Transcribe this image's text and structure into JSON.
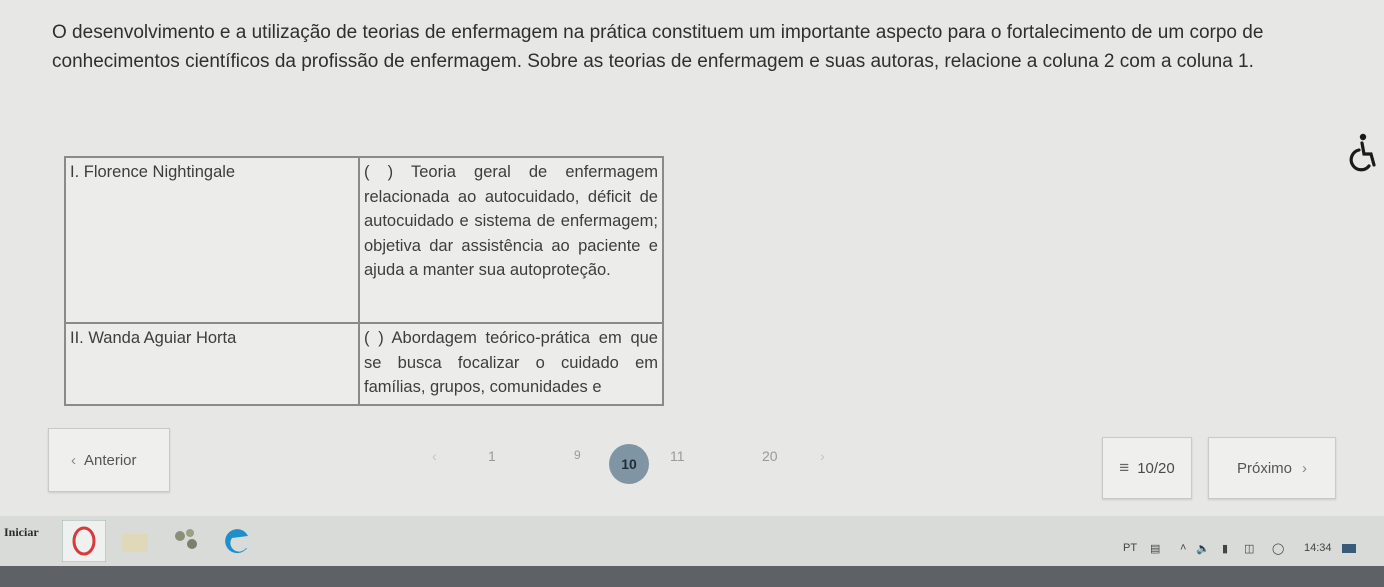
{
  "question": {
    "text": "O desenvolvimento e a utilização de teorias de enfermagem na prática constituem um importante aspecto para o fortalecimento de um corpo de conhecimentos científicos da profissão de enfermagem. Sobre as teorias de enfermagem e suas autoras, relacione a coluna 2 com a coluna 1."
  },
  "table": {
    "rows": [
      {
        "left": "I. Florence Nightingale",
        "right": "( ) Teoria geral de enfermagem relacionada ao autocuidado, déficit de autocuidado e sistema de enfermagem; objetiva dar assistência ao paciente e ajuda a manter sua autoproteção."
      },
      {
        "left": "II. Wanda Aguiar Horta",
        "right": "( ) Abordagem teórico-prática em que se busca focalizar o cuidado em famílias, grupos, comunidades e"
      }
    ]
  },
  "navigation": {
    "prev_label": "Anterior",
    "next_label": "Próximo",
    "counter": "10/20",
    "pages": [
      "1",
      "9",
      "10",
      "11",
      "20"
    ],
    "active_page": "10",
    "prev_icon": "chevron-left-icon",
    "next_icon": "chevron-right-icon",
    "list_icon": "list-icon"
  },
  "taskbar": {
    "start_label": "Iniciar",
    "language": "PT",
    "time": "14:34"
  },
  "colors": {
    "background": "#e7e7e5",
    "active_page": "#7f95a3",
    "taskbar": "#d9dbd8"
  }
}
